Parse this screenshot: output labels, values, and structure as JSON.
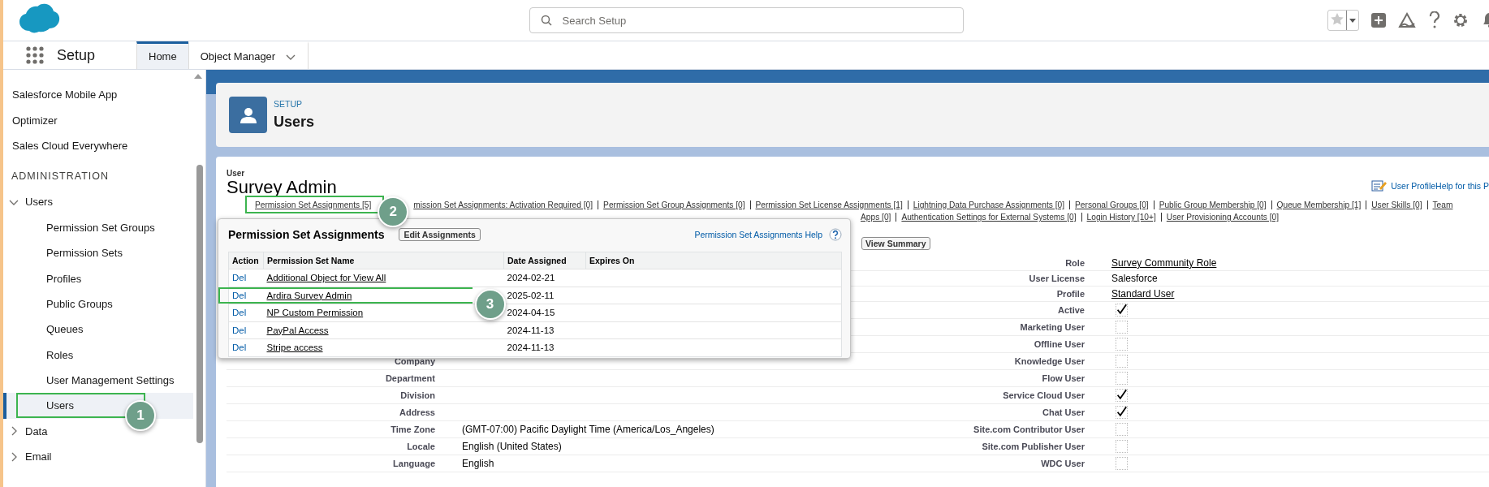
{
  "header": {
    "search": {
      "placeholder": "Search Setup"
    }
  },
  "nav": {
    "app_name": "Setup",
    "tabs": [
      {
        "label": "Home",
        "selected": true,
        "kind": "tab"
      },
      {
        "label": "Object Manager",
        "selected": false,
        "kind": "menu"
      }
    ]
  },
  "sidebar": {
    "items": [
      {
        "kind": "link",
        "label": "Salesforce Mobile App",
        "selected": false
      },
      {
        "kind": "link",
        "label": "Optimizer",
        "selected": false
      },
      {
        "kind": "link",
        "label": "Sales Cloud Everywhere",
        "selected": false
      },
      {
        "kind": "heading",
        "label": "ADMINISTRATION"
      },
      {
        "kind": "group",
        "label": "Users",
        "expanded": true,
        "children": [
          {
            "label": "Permission Set Groups",
            "selected": false
          },
          {
            "label": "Permission Sets",
            "selected": false
          },
          {
            "label": "Profiles",
            "selected": false
          },
          {
            "label": "Public Groups",
            "selected": false
          },
          {
            "label": "Queues",
            "selected": false
          },
          {
            "label": "Roles",
            "selected": false
          },
          {
            "label": "User Management Settings",
            "selected": false
          },
          {
            "label": "Users",
            "selected": true,
            "callout": "1"
          }
        ]
      },
      {
        "kind": "group",
        "label": "Data",
        "expanded": false
      },
      {
        "kind": "group",
        "label": "Email",
        "expanded": false
      }
    ]
  },
  "page_header": {
    "eyebrow": "SETUP",
    "title": "Users"
  },
  "user": {
    "caption": "User",
    "name": "Survey Admin",
    "help_link": "User ProfileHelp for this P"
  },
  "related_links": [
    [
      {
        "label": "Permission Set Assignments [5]",
        "callout": "2"
      },
      {
        "label": "mission Set Assignments: Activation Required [0]"
      },
      {
        "label": "Permission Set Group Assignments [0]"
      },
      {
        "label": "Permission Set License Assignments [1]"
      },
      {
        "label": "Lightning Data Purchase Assignments [0]"
      },
      {
        "label": "Personal Groups [0]"
      },
      {
        "label": "Public Group Membership [0]"
      },
      {
        "label": "Queue Membership [1]"
      },
      {
        "label": "User Skills [0]"
      },
      {
        "label": "Team"
      }
    ],
    [
      {
        "label": "Apps [0]"
      },
      {
        "label": "Authentication Settings for External Systems [0]"
      },
      {
        "label": "Login History [10+]"
      },
      {
        "label": "User Provisioning Accounts [0]"
      }
    ]
  ],
  "buttons": [
    "View Summary"
  ],
  "popup": {
    "title": "Permission Set Assignments",
    "button": "Edit Assignments",
    "help_link": "Permission Set Assignments Help",
    "columns": [
      "Action",
      "Permission Set Name",
      "Date Assigned",
      "Expires On"
    ],
    "rows": [
      {
        "action": "Del",
        "name": "Additional Object for View All",
        "date": "2024-02-21"
      },
      {
        "action": "Del",
        "name": "Ardira Survey Admin",
        "date": "2025-02-11",
        "callout": "3"
      },
      {
        "action": "Del",
        "name": "NP Custom Permission",
        "date": "2024-04-15"
      },
      {
        "action": "Del",
        "name": "PayPal Access",
        "date": "2024-11-13"
      },
      {
        "action": "Del",
        "name": "Stripe access",
        "date": "2024-11-13"
      }
    ]
  },
  "details": [
    {
      "right": {
        "label": "Role",
        "kind": "link",
        "value": "Survey Community Role"
      }
    },
    {
      "right": {
        "label": "User License",
        "kind": "text",
        "value": "Salesforce"
      }
    },
    {
      "right": {
        "label": "Profile",
        "kind": "link",
        "value": "Standard User"
      }
    },
    {
      "right": {
        "label": "Active",
        "kind": "checkbox",
        "checked": true
      }
    },
    {
      "right": {
        "label": "Marketing User",
        "kind": "checkbox",
        "checked": false
      }
    },
    {
      "right": {
        "label": "Offline User",
        "kind": "checkbox",
        "checked": false
      }
    },
    {
      "left": {
        "label": "Company"
      },
      "right": {
        "label": "Knowledge User",
        "kind": "checkbox",
        "checked": false
      }
    },
    {
      "left": {
        "label": "Department"
      },
      "right": {
        "label": "Flow User",
        "kind": "checkbox",
        "checked": false
      }
    },
    {
      "left": {
        "label": "Division"
      },
      "right": {
        "label": "Service Cloud User",
        "kind": "checkbox",
        "checked": true
      }
    },
    {
      "left": {
        "label": "Address"
      },
      "right": {
        "label": "Chat User",
        "kind": "checkbox",
        "checked": true
      }
    },
    {
      "left": {
        "label": "Time Zone",
        "kind": "text",
        "value": "(GMT-07:00) Pacific Daylight Time (America/Los_Angeles)"
      },
      "right": {
        "label": "Site.com Contributor User",
        "kind": "checkbox",
        "checked": false
      }
    },
    {
      "left": {
        "label": "Locale",
        "kind": "text",
        "value": "English (United States)"
      },
      "right": {
        "label": "Site.com Publisher User",
        "kind": "checkbox",
        "checked": false
      }
    },
    {
      "left": {
        "label": "Language",
        "kind": "text",
        "value": "English"
      },
      "right": {
        "label": "WDC User",
        "kind": "checkbox",
        "checked": false
      }
    }
  ]
}
